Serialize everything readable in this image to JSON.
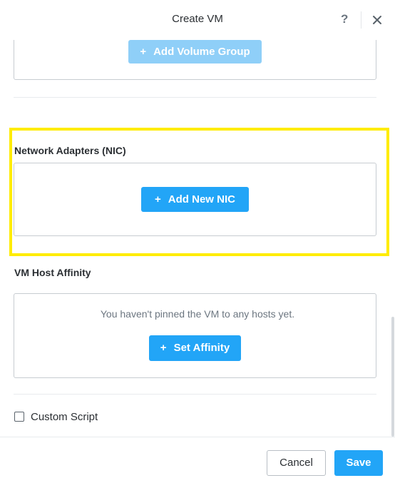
{
  "dialog": {
    "title": "Create VM",
    "help_icon": "question-mark-icon",
    "help_glyph": "?",
    "close_icon": "close-icon"
  },
  "volume_groups": {
    "add_button": {
      "plus": "+",
      "label": "Add Volume Group",
      "state": "disabled"
    }
  },
  "network_adapters": {
    "label": "Network Adapters (NIC)",
    "highlighted": true,
    "highlight_color": "#ffec00",
    "add_button": {
      "plus": "+",
      "label": "Add New NIC"
    }
  },
  "vm_host_affinity": {
    "label": "VM Host Affinity",
    "empty_message": "You haven't pinned the VM to any hosts yet.",
    "set_button": {
      "plus": "+",
      "label": "Set Affinity"
    }
  },
  "custom_script": {
    "label": "Custom Script",
    "checked": false
  },
  "footer": {
    "cancel_label": "Cancel",
    "save_label": "Save"
  },
  "colors": {
    "primary": "#22a5f7",
    "primary_disabled": "#8fcff8",
    "border": "#c7ccd1",
    "text": "#2b2f33",
    "muted_text": "#6c7680"
  }
}
